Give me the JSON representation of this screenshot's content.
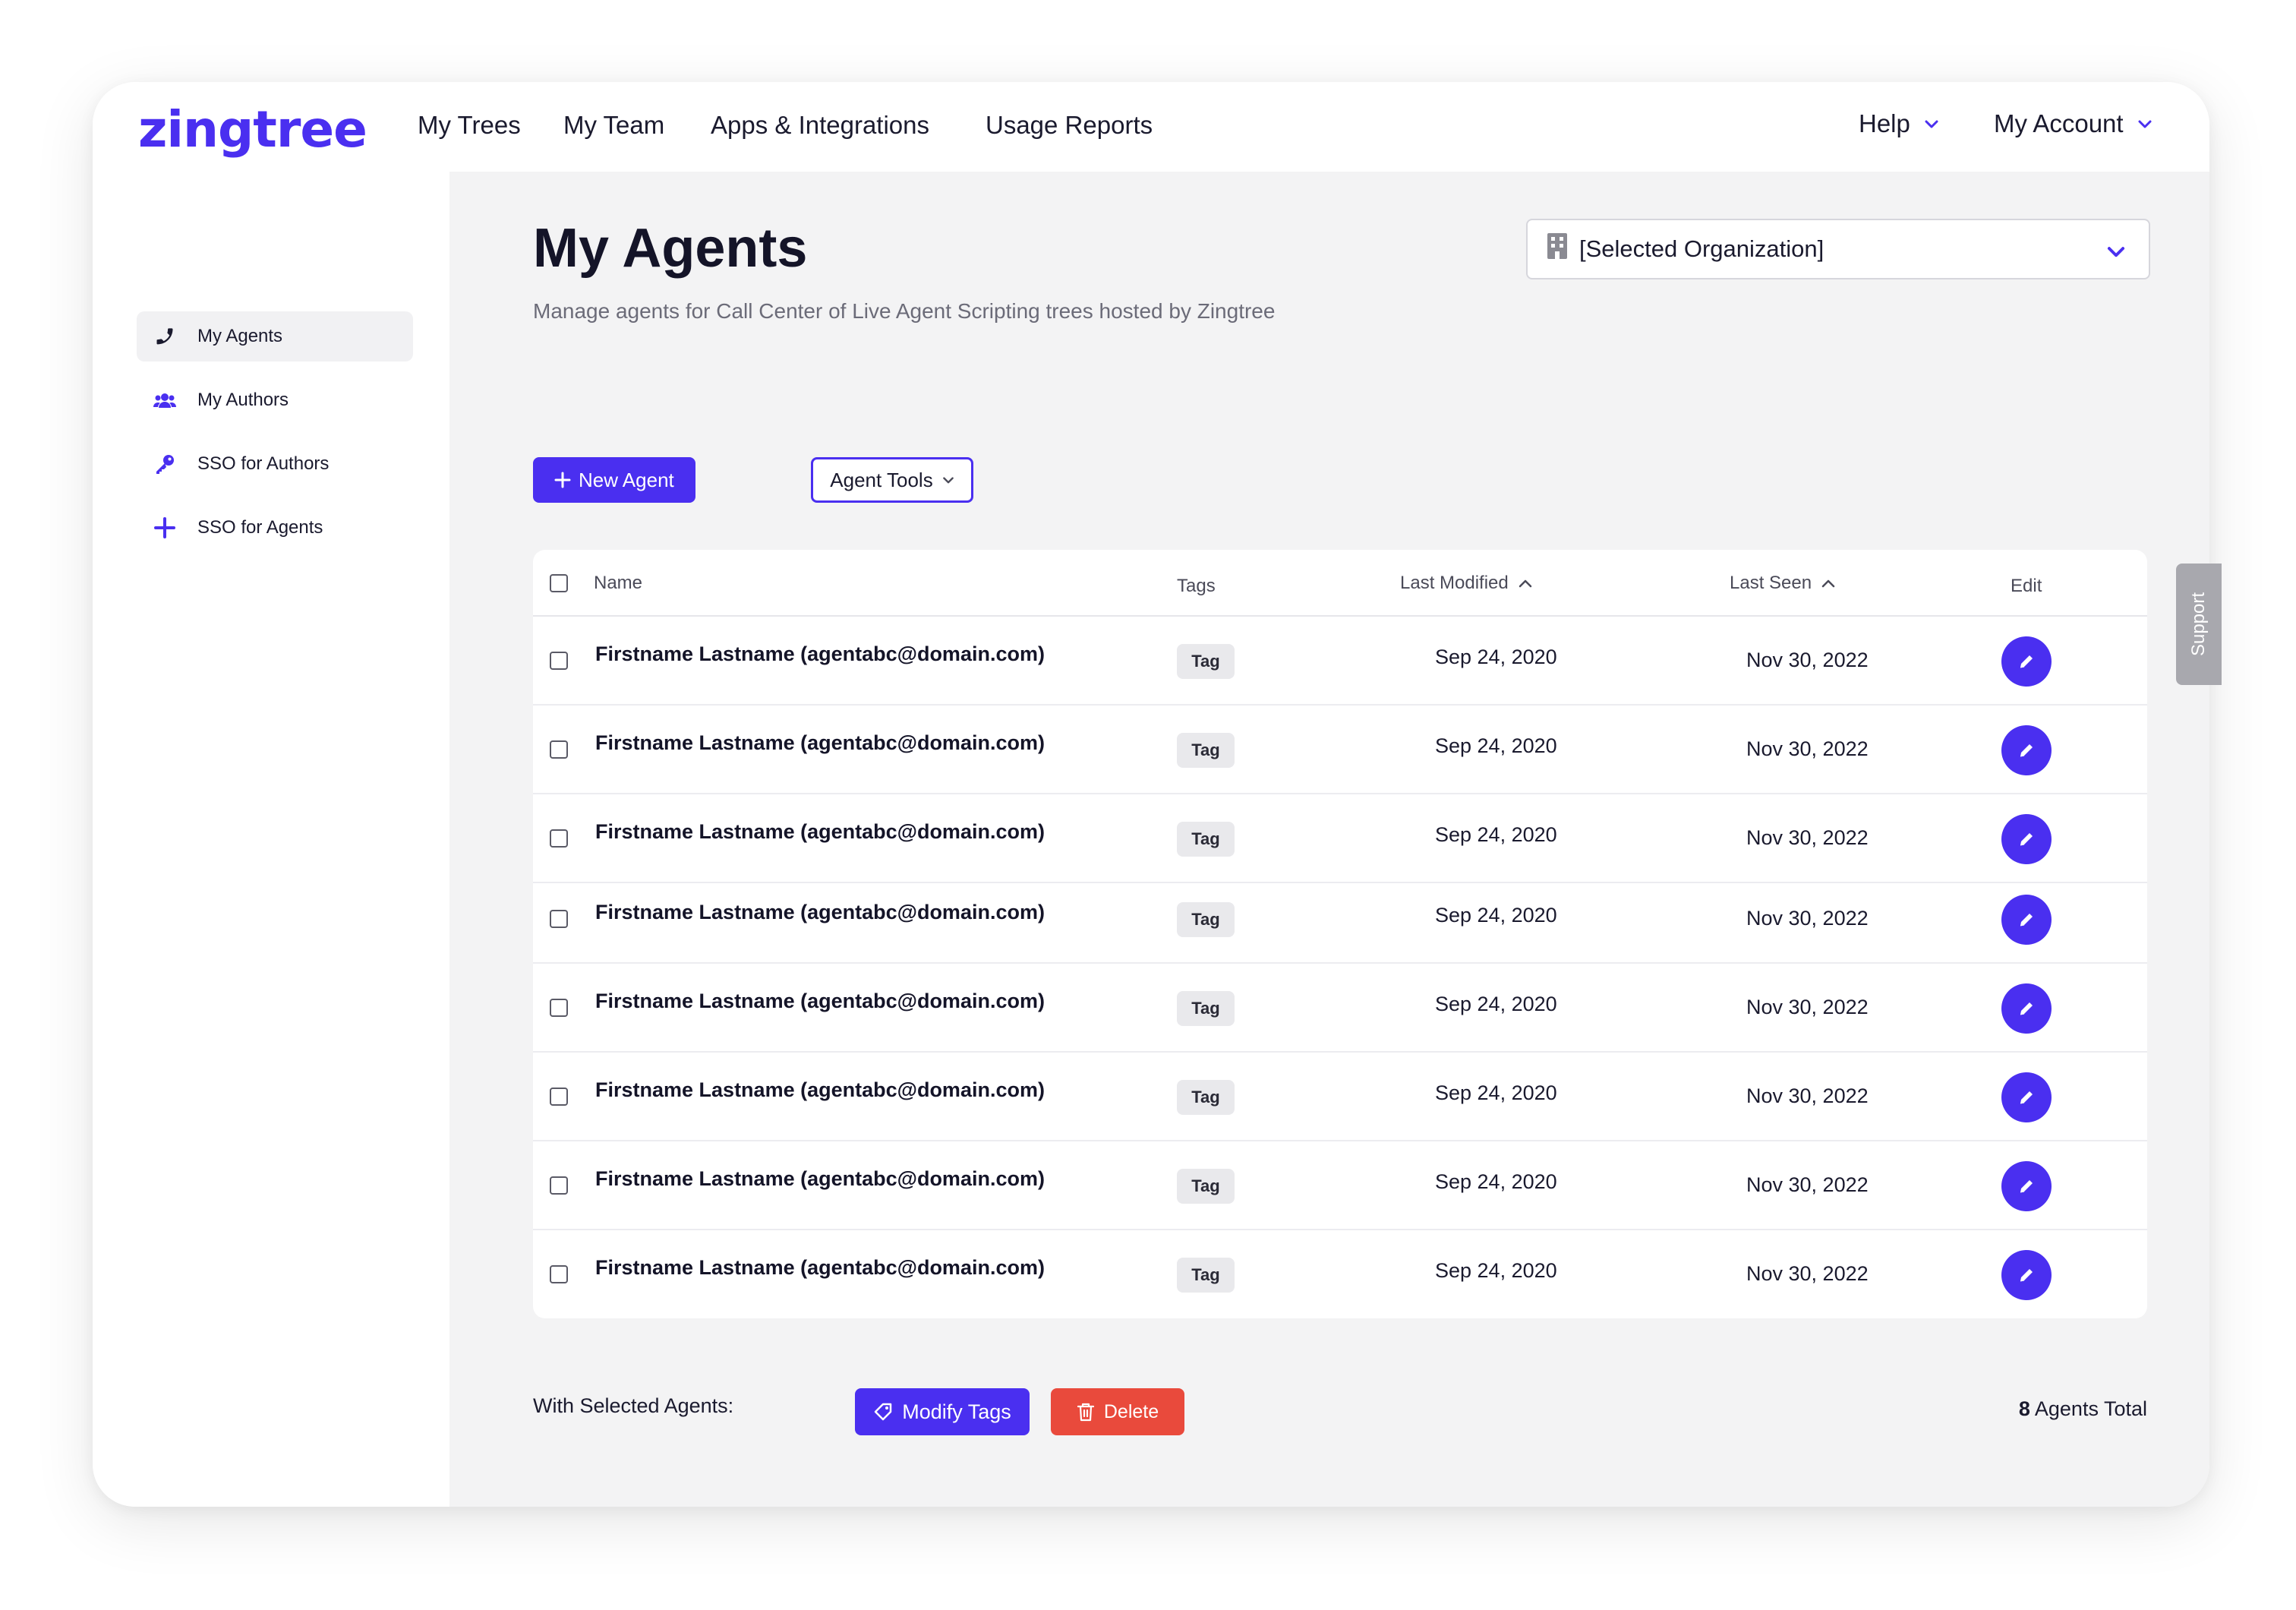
{
  "brand": {
    "logo_text": "zingtree",
    "accent": "#4a2ff0",
    "danger": "#e94a3c"
  },
  "topnav": {
    "items": [
      "My Trees",
      "My Team",
      "Apps & Integrations",
      "Usage Reports"
    ],
    "help": "Help",
    "account": "My Account"
  },
  "sidebar": {
    "items": [
      {
        "label": "My Agents",
        "icon": "phone-icon",
        "active": true
      },
      {
        "label": "My Authors",
        "icon": "users-icon",
        "active": false
      },
      {
        "label": "SSO for Authors",
        "icon": "key-icon",
        "active": false
      },
      {
        "label": "SSO for Agents",
        "icon": "plus-icon",
        "active": false
      }
    ]
  },
  "page": {
    "title": "My Agents",
    "subtitle": "Manage agents for Call Center of Live Agent Scripting trees hosted by Zingtree",
    "org_select": "[Selected Organization]",
    "new_agent": "New Agent",
    "agent_tools": "Agent Tools"
  },
  "table": {
    "headers": {
      "name": "Name",
      "tags": "Tags",
      "last_modified": "Last Modified",
      "last_seen": "Last Seen",
      "edit": "Edit"
    },
    "rows": [
      {
        "name": "Firstname Lastname (agentabc@domain.com)",
        "tag": "Tag",
        "modified": "Sep 24, 2020",
        "seen": "Nov 30, 2022"
      },
      {
        "name": "Firstname Lastname (agentabc@domain.com)",
        "tag": "Tag",
        "modified": "Sep 24, 2020",
        "seen": "Nov 30, 2022"
      },
      {
        "name": "Firstname Lastname (agentabc@domain.com)",
        "tag": "Tag",
        "modified": "Sep 24, 2020",
        "seen": "Nov 30, 2022"
      },
      {
        "name": "Firstname Lastname (agentabc@domain.com)",
        "tag": "Tag",
        "modified": "Sep 24, 2020",
        "seen": "Nov 30, 2022"
      },
      {
        "name": "Firstname Lastname (agentabc@domain.com)",
        "tag": "Tag",
        "modified": "Sep 24, 2020",
        "seen": "Nov 30, 2022"
      },
      {
        "name": "Firstname Lastname (agentabc@domain.com)",
        "tag": "Tag",
        "modified": "Sep 24, 2020",
        "seen": "Nov 30, 2022"
      },
      {
        "name": "Firstname Lastname (agentabc@domain.com)",
        "tag": "Tag",
        "modified": "Sep 24, 2020",
        "seen": "Nov 30, 2022"
      },
      {
        "name": "Firstname Lastname (agentabc@domain.com)",
        "tag": "Tag",
        "modified": "Sep 24, 2020",
        "seen": "Nov 30, 2022"
      }
    ]
  },
  "footer": {
    "with_selected": "With Selected Agents:",
    "modify_tags": "Modify Tags",
    "delete": "Delete",
    "total_count": "8",
    "total_label": "Agents Total"
  },
  "support": {
    "label": "Support"
  }
}
